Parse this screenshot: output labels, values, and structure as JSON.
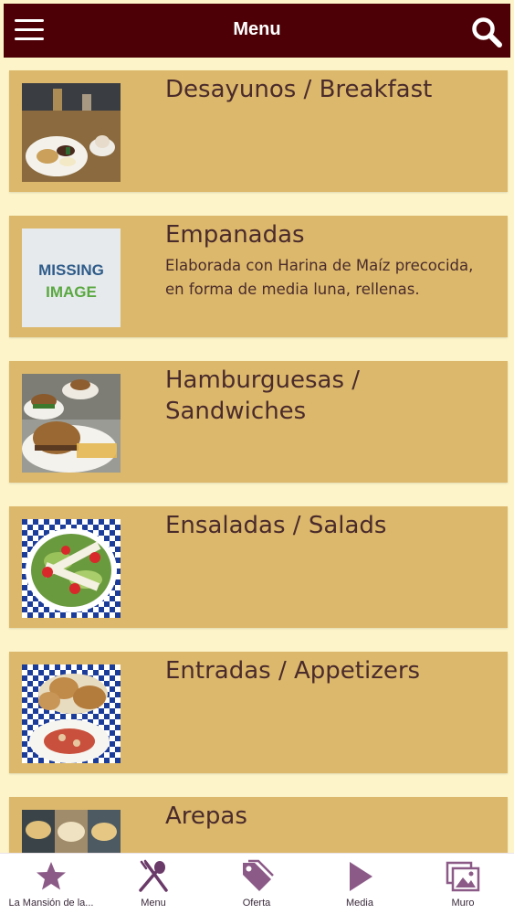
{
  "header": {
    "title": "Menu",
    "menu_icon": "hamburger-menu-icon",
    "search_icon": "search-icon"
  },
  "colors": {
    "header_bg": "#4d0106",
    "page_bg": "#fdf5c9",
    "card_bg": "#dcb86c",
    "text": "#4a2b2b",
    "tab_icon": "#8b5a87"
  },
  "categories": [
    {
      "name": "Desayunos / Breakfast",
      "description": "",
      "image": "breakfast-photo"
    },
    {
      "name": "Empanadas",
      "description": "Elaborada con Harina de Maíz precocida, en forma de media luna, rellenas.",
      "image": "missing-image-placeholder",
      "image_text_1": "MISSING",
      "image_text_2": "IMAGE"
    },
    {
      "name": "Hamburguesas / Sandwiches",
      "description": "",
      "image": "burgers-photo"
    },
    {
      "name": "Ensaladas / Salads",
      "description": "",
      "image": "salad-photo"
    },
    {
      "name": "Entradas / Appetizers",
      "description": "",
      "image": "appetizers-photo"
    },
    {
      "name": "Arepas",
      "description": "",
      "image": "arepas-photo"
    }
  ],
  "tabs": [
    {
      "label": "La Mansión de la...",
      "icon": "star-icon"
    },
    {
      "label": "Menu",
      "icon": "utensils-icon"
    },
    {
      "label": "Oferta",
      "icon": "tags-icon"
    },
    {
      "label": "Media",
      "icon": "play-icon"
    },
    {
      "label": "Muro",
      "icon": "photos-icon"
    }
  ]
}
